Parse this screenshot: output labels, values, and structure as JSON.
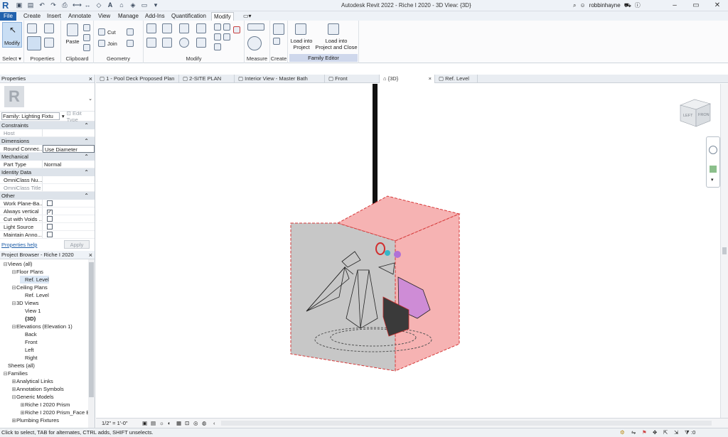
{
  "app": {
    "title": "Autodesk Revit 2022 - Riche I 2020 - 3D View: {3D}",
    "username": "robbinhayne",
    "logo_letter": "R"
  },
  "tabs": [
    "File",
    "Create",
    "Insert",
    "Annotate",
    "View",
    "Manage",
    "Add-Ins",
    "Quantification",
    "Modify"
  ],
  "ribbon": {
    "modify_label": "Modify",
    "select_label": "Select ▾",
    "properties_label": "Properties",
    "paste_label": "Paste",
    "clipboard_label": "Clipboard",
    "cut_label": "Cut",
    "join_label": "Join",
    "geometry_label": "Geometry",
    "modify_panel_label": "Modify",
    "measure_label": "Measure",
    "create_label": "Create",
    "load_into_project": "Load into\nProject",
    "load_into_project_close": "Load into\nProject and Close",
    "family_editor_label": "Family Editor"
  },
  "properties": {
    "title": "Properties",
    "family_selector": "Family: Lighting Fixtu",
    "edit_type": "Edit Type",
    "sections": [
      {
        "name": "Constraints",
        "rows": [
          {
            "k": "Host",
            "v": "",
            "grey": true
          }
        ]
      },
      {
        "name": "Dimensions",
        "rows": [
          {
            "k": "Round Connec...",
            "v": "Use Diameter",
            "box": true
          }
        ]
      },
      {
        "name": "Mechanical",
        "rows": [
          {
            "k": "Part Type",
            "v": "Normal"
          }
        ]
      },
      {
        "name": "Identity Data",
        "rows": [
          {
            "k": "OmniClass Nu...",
            "v": ""
          },
          {
            "k": "OmniClass Title",
            "v": "",
            "grey": true
          }
        ]
      },
      {
        "name": "Other",
        "rows": [
          {
            "k": "Work Plane-Ba...",
            "chk": false
          },
          {
            "k": "Always vertical",
            "chk": true
          },
          {
            "k": "Cut with Voids ...",
            "chk": false
          },
          {
            "k": "Light Source",
            "chk": false
          },
          {
            "k": "Maintain Anno...",
            "chk": false
          }
        ]
      }
    ],
    "help_link": "Properties help",
    "apply": "Apply"
  },
  "browser": {
    "title": "Project Browser - Riche I 2020",
    "items": [
      {
        "label": "Views (all)",
        "indent": 0,
        "exp": "⊟"
      },
      {
        "label": "Floor Plans",
        "indent": 1,
        "exp": "⊟"
      },
      {
        "label": "Ref. Level",
        "indent": 2,
        "exp": "",
        "selected": true
      },
      {
        "label": "Ceiling Plans",
        "indent": 1,
        "exp": "⊟"
      },
      {
        "label": "Ref. Level",
        "indent": 2,
        "exp": ""
      },
      {
        "label": "3D Views",
        "indent": 1,
        "exp": "⊟"
      },
      {
        "label": "View 1",
        "indent": 2,
        "exp": ""
      },
      {
        "label": "{3D}",
        "indent": 2,
        "exp": "",
        "bold": true
      },
      {
        "label": "Elevations (Elevation 1)",
        "indent": 1,
        "exp": "⊟"
      },
      {
        "label": "Back",
        "indent": 2,
        "exp": ""
      },
      {
        "label": "Front",
        "indent": 2,
        "exp": ""
      },
      {
        "label": "Left",
        "indent": 2,
        "exp": ""
      },
      {
        "label": "Right",
        "indent": 2,
        "exp": ""
      },
      {
        "label": "Sheets (all)",
        "indent": 0,
        "exp": ""
      },
      {
        "label": "Families",
        "indent": 0,
        "exp": "⊟"
      },
      {
        "label": "Analytical Links",
        "indent": 1,
        "exp": "⊞"
      },
      {
        "label": "Annotation Symbols",
        "indent": 1,
        "exp": "⊞"
      },
      {
        "label": "Generic Models",
        "indent": 1,
        "exp": "⊟"
      },
      {
        "label": "Riche I 2020 Prism",
        "indent": 2,
        "exp": "⊞"
      },
      {
        "label": "Riche I 2020 Prism_Face B",
        "indent": 2,
        "exp": "⊞"
      },
      {
        "label": "Plumbing Fixtures",
        "indent": 1,
        "exp": "⊞"
      }
    ]
  },
  "doc_tabs": [
    {
      "label": "1 - Pool Deck Proposed Plan"
    },
    {
      "label": "2-SITE PLAN"
    },
    {
      "label": "Interior View - Master Bath"
    },
    {
      "label": "Front"
    },
    {
      "label": "{3D}",
      "active": true
    },
    {
      "label": "Ref. Level"
    }
  ],
  "viewcube": {
    "left": "LEFT",
    "front": "FRON"
  },
  "view_control": {
    "scale": "1/2\" = 1'-0\""
  },
  "status": {
    "text": "Click to select, TAB for alternates, CTRL adds, SHIFT unselects.",
    "filter_count": ":0"
  }
}
